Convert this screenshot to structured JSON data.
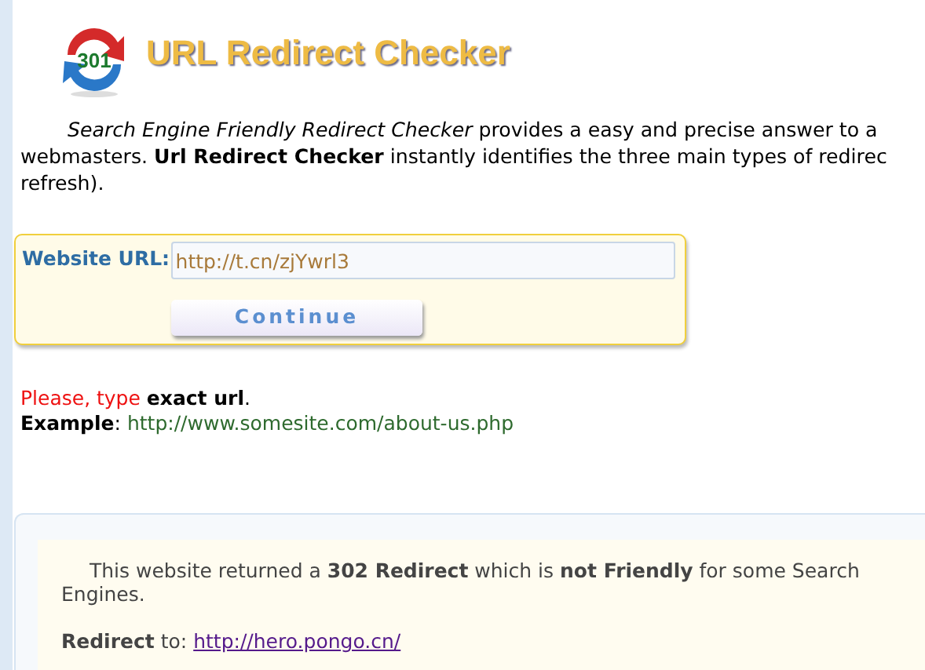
{
  "header": {
    "logo_text": "301",
    "title": "URL Redirect Checker"
  },
  "intro": "*Search Engine Friendly Redirect Checker* provides a easy and precise answer to a\nwebmasters. **Url Redirect Checker** instantly identifies the three main types of redirec\nrefresh).",
  "form": {
    "label": "Website URL:",
    "value": "http://t.cn/zjYwrl3",
    "button": "Continue"
  },
  "hints": [
    [
      {
        "kind": "warning",
        "text": "Please, type "
      },
      {
        "kind": "strong",
        "text": "exact url"
      },
      {
        "kind": "plain",
        "text": "."
      }
    ],
    [
      {
        "kind": "strong",
        "text": "Example"
      },
      {
        "kind": "plain",
        "text": ": "
      },
      {
        "kind": "example",
        "text": "http://www.somesite.com/about-us.php"
      }
    ]
  ],
  "result": {
    "message": "This website returned a **302 Redirect** which is **not Friendly** for some Search Engines.",
    "redirect_label": "**Redirect** to:",
    "redirect_url": "http://hero.pongo.cn/"
  }
}
